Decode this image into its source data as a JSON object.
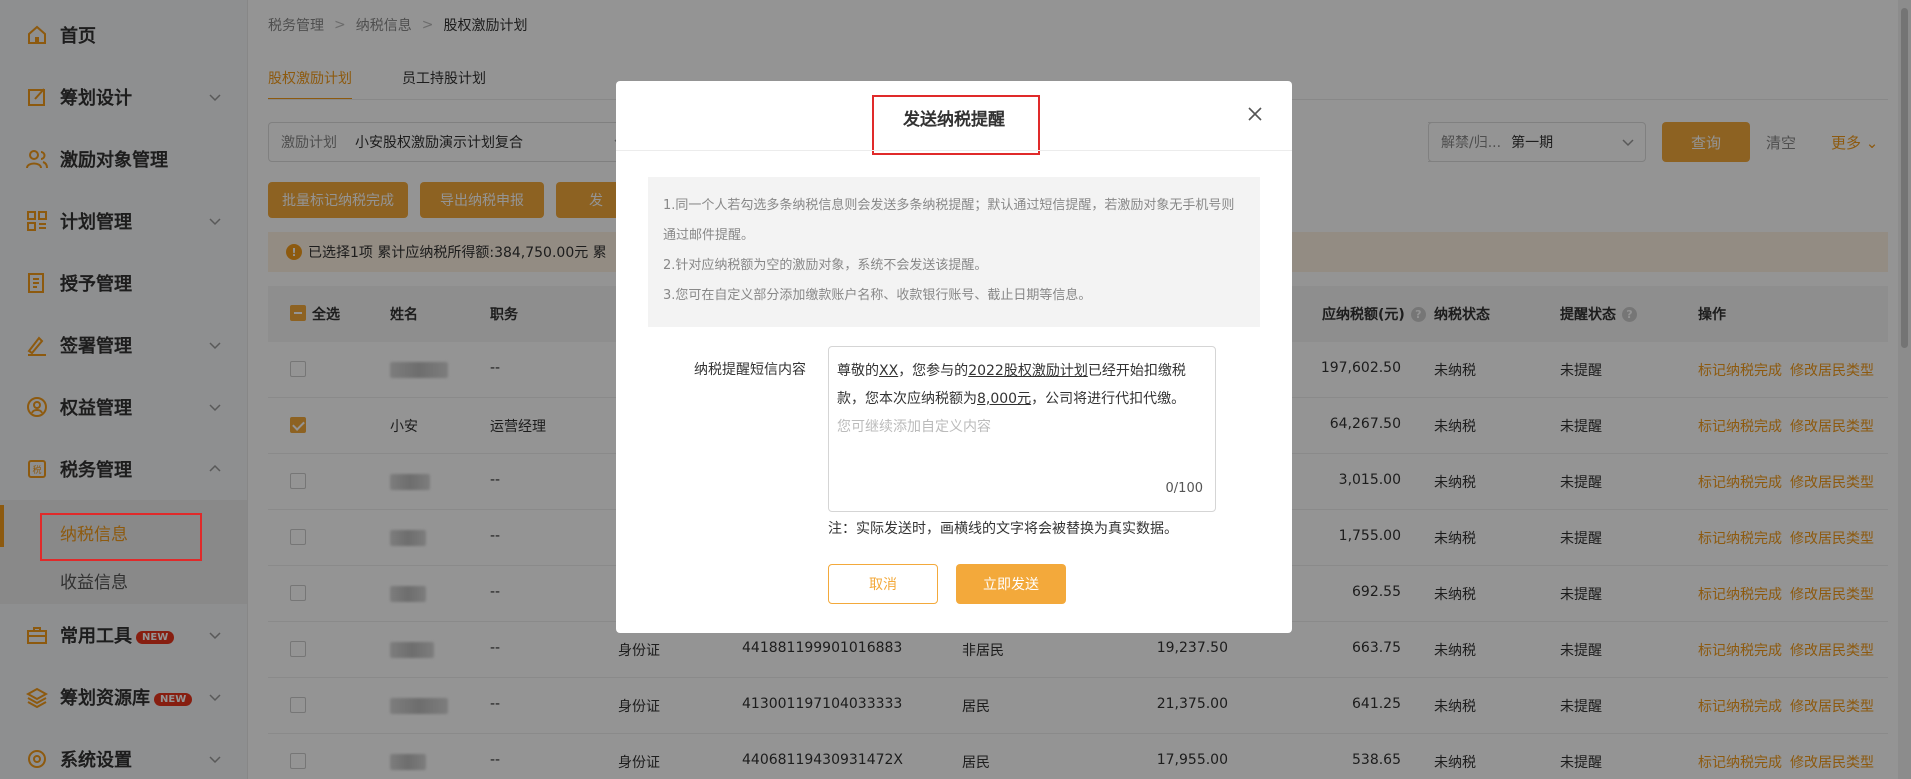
{
  "sidebar": {
    "items": [
      {
        "label": "首页",
        "icon": "home-icon"
      },
      {
        "label": "筹划设计",
        "icon": "edit-icon"
      },
      {
        "label": "激励对象管理",
        "icon": "users-icon"
      },
      {
        "label": "计划管理",
        "icon": "grid-icon"
      },
      {
        "label": "授予管理",
        "icon": "document-icon"
      },
      {
        "label": "签署管理",
        "icon": "sign-icon"
      },
      {
        "label": "权益管理",
        "icon": "equity-icon"
      },
      {
        "label": "税务管理",
        "icon": "tax-icon"
      },
      {
        "label": "常用工具",
        "icon": "toolbox-icon",
        "badge": "NEW"
      },
      {
        "label": "筹划资源库",
        "icon": "layers-icon",
        "badge": "NEW"
      },
      {
        "label": "系统设置",
        "icon": "settings-icon"
      }
    ],
    "sub_items": [
      {
        "label": "纳税信息",
        "active": true
      },
      {
        "label": "收益信息",
        "active": false
      }
    ]
  },
  "breadcrumb": [
    "税务管理",
    "纳税信息",
    "股权激励计划"
  ],
  "tabs": [
    {
      "label": "股权激励计划",
      "active": true
    },
    {
      "label": "员工持股计划",
      "active": false
    }
  ],
  "filters": {
    "plan_label": "激励计划",
    "plan_value": "小安股权激励演示计划复合",
    "period_label": "解禁/归...",
    "period_value": "第一期",
    "query_label": "查询",
    "clear_label": "清空",
    "more_label": "更多"
  },
  "actions": {
    "batch_mark": "批量标记纳税完成",
    "export": "导出纳税申报",
    "send_partial": "发"
  },
  "info_bar": {
    "text": "已选择1项 累计应纳税所得额:384,750.00元 累"
  },
  "table": {
    "headers": {
      "select_all": "全选",
      "name": "姓名",
      "position": "职务",
      "tax_payable": "应纳税额(元)",
      "tax_status": "纳税状态",
      "remind_status": "提醒状态",
      "ops": "操作"
    },
    "rows": [
      {
        "name": "",
        "position": "--",
        "id_type": "",
        "id_no": "",
        "resident": "",
        "income": "",
        "tax": "197,602.50",
        "tax_status": "未纳税",
        "remind": "未提醒",
        "checked": false
      },
      {
        "name": "小安",
        "position": "运营经理",
        "id_type": "",
        "id_no": "",
        "resident": "",
        "income": "",
        "tax": "64,267.50",
        "tax_status": "未纳税",
        "remind": "未提醒",
        "checked": true
      },
      {
        "name": "",
        "position": "--",
        "id_type": "",
        "id_no": "",
        "resident": "",
        "income": "",
        "tax": "3,015.00",
        "tax_status": "未纳税",
        "remind": "未提醒",
        "checked": false
      },
      {
        "name": "",
        "position": "--",
        "id_type": "",
        "id_no": "",
        "resident": "",
        "income": "",
        "tax": "1,755.00",
        "tax_status": "未纳税",
        "remind": "未提醒",
        "checked": false
      },
      {
        "name": "",
        "position": "--",
        "id_type": "",
        "id_no": "",
        "resident": "",
        "income": "",
        "tax": "692.55",
        "tax_status": "未纳税",
        "remind": "未提醒",
        "checked": false
      },
      {
        "name": "",
        "position": "--",
        "id_type": "身份证",
        "id_no": "441881199901016883",
        "resident": "非居民",
        "income": "19,237.50",
        "tax": "663.75",
        "tax_status": "未纳税",
        "remind": "未提醒",
        "checked": false
      },
      {
        "name": "",
        "position": "--",
        "id_type": "身份证",
        "id_no": "413001197104033333",
        "resident": "居民",
        "income": "21,375.00",
        "tax": "641.25",
        "tax_status": "未纳税",
        "remind": "未提醒",
        "checked": false
      },
      {
        "name": "",
        "position": "--",
        "id_type": "身份证",
        "id_no": "44068119430931472X",
        "resident": "居民",
        "income": "17,955.00",
        "tax": "538.65",
        "tax_status": "未纳税",
        "remind": "未提醒",
        "checked": false
      }
    ],
    "op_mark": "标记纳税完成",
    "op_modify": "修改居民类型"
  },
  "modal": {
    "title": "发送纳税提醒",
    "notices": [
      "1.同一个人若勾选多条纳税信息则会发送多条纳税提醒；默认通过短信提醒，若激励对象无手机号则通过邮件提醒。",
      "2.针对应纳税额为空的激励对象，系统不会发送该提醒。",
      "3.您可在自定义部分添加缴款账户名称、收款银行账号、截止日期等信息。"
    ],
    "form_label": "纳税提醒短信内容",
    "msg_part1": "尊敬的",
    "msg_name": "XX",
    "msg_part2": "，您参与的",
    "msg_plan": "2022股权激励计划",
    "msg_part3": "已经开始扣缴税款，您本次应纳税额为",
    "msg_amount": "8,000元",
    "msg_part4": "，公司将进行代扣代缴。",
    "placeholder": "您可继续添加自定义内容",
    "counter": "0/100",
    "note": "注：实际发送时，画横线的文字将会被替换为真实数据。",
    "cancel": "取消",
    "send": "立即发送"
  },
  "colors": {
    "accent": "#f3a93b",
    "highlight_red": "#e02a2a"
  }
}
